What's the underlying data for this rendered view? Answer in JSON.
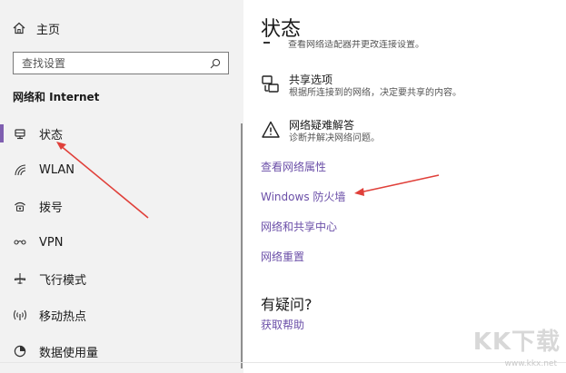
{
  "sidebar": {
    "home_label": "主页",
    "search_placeholder": "查找设置",
    "section_title": "网络和 Internet",
    "items": [
      {
        "label": "状态",
        "icon": "network-status-icon",
        "active": true
      },
      {
        "label": "WLAN",
        "icon": "wifi-icon"
      },
      {
        "label": "拨号",
        "icon": "dialup-icon"
      },
      {
        "label": "VPN",
        "icon": "vpn-icon"
      },
      {
        "label": "飞行模式",
        "icon": "airplane-icon"
      },
      {
        "label": "移动热点",
        "icon": "hotspot-icon"
      },
      {
        "label": "数据使用量",
        "icon": "data-usage-icon"
      }
    ]
  },
  "main": {
    "title": "状态",
    "clipped_text": "查看网络适配器并更改连接设置。",
    "options": [
      {
        "title": "共享选项",
        "desc": "根据所连接到的网络，决定要共享的内容。",
        "icon": "sharing-icon"
      },
      {
        "title": "网络疑难解答",
        "desc": "诊断并解决网络问题。",
        "icon": "warning-icon"
      }
    ],
    "links": [
      "查看网络属性",
      "Windows 防火墙",
      "网络和共享中心",
      "网络重置"
    ],
    "help": {
      "title": "有疑问?",
      "link": "获取帮助"
    }
  },
  "watermark": {
    "logo": "KK下载",
    "url": "www.kkx.net"
  },
  "colors": {
    "accent": "#7f5fb0",
    "link": "#6b4fa8",
    "arrow": "#e0403a",
    "sidebar_bg": "#f2f2f2"
  }
}
